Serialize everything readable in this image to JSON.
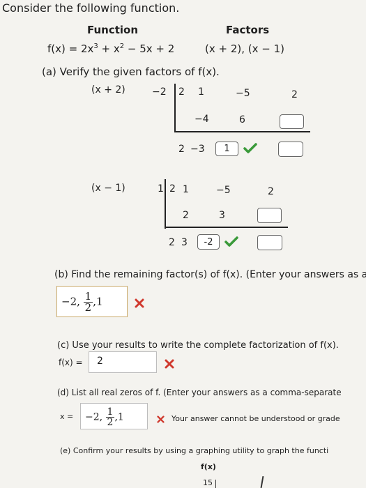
{
  "intro": "Consider the following function.",
  "headers": {
    "function": "Function",
    "factors": "Factors"
  },
  "function_expr": {
    "lhs": "f(x) = 2x",
    "exp3": "3",
    "mid": " + x",
    "exp2": "2",
    "rhs": " − 5x + 2"
  },
  "factors_expr": "(x + 2), (x − 1)",
  "part_a": {
    "label": "(a) Verify the given factors of f(x)."
  },
  "div1": {
    "factor": "(x + 2)",
    "divisor": "−2",
    "row1": [
      "2",
      "1",
      "−5",
      "2"
    ],
    "row2": [
      "−4",
      "6"
    ],
    "row3": [
      "2",
      "−3"
    ],
    "answer": "1"
  },
  "div2": {
    "factor": "(x − 1)",
    "divisor": "1",
    "row1": [
      "2",
      "1",
      "−5",
      "2"
    ],
    "row2": [
      "2",
      "3"
    ],
    "row3": [
      "2",
      "3"
    ],
    "answer": "-2"
  },
  "part_b": {
    "label": "(b) Find the remaining factor(s) of f(x). (Enter your answers as a",
    "answer_pre": "−2, ",
    "frac_num": "1",
    "frac_den": "2",
    "answer_post": ",1"
  },
  "part_c": {
    "label": "(c) Use your results to write the complete factorization of f(x).",
    "prefix": "f(x) =",
    "answer": "2"
  },
  "part_d": {
    "label": "(d) List all real zeros of f. (Enter your answers as a comma-separate",
    "prefix": "x =",
    "answer_pre": "−2, ",
    "frac_num": "1",
    "frac_den": "2",
    "answer_post": ",1",
    "error": "Your answer cannot be understood or grade"
  },
  "part_e": {
    "label": "(e) Confirm your results by using a graphing utility to graph the functi",
    "graph_label": "f(x)",
    "graph_tick": "15"
  },
  "colors": {
    "correct": "#3a9a3a",
    "incorrect": "#d0392e"
  }
}
